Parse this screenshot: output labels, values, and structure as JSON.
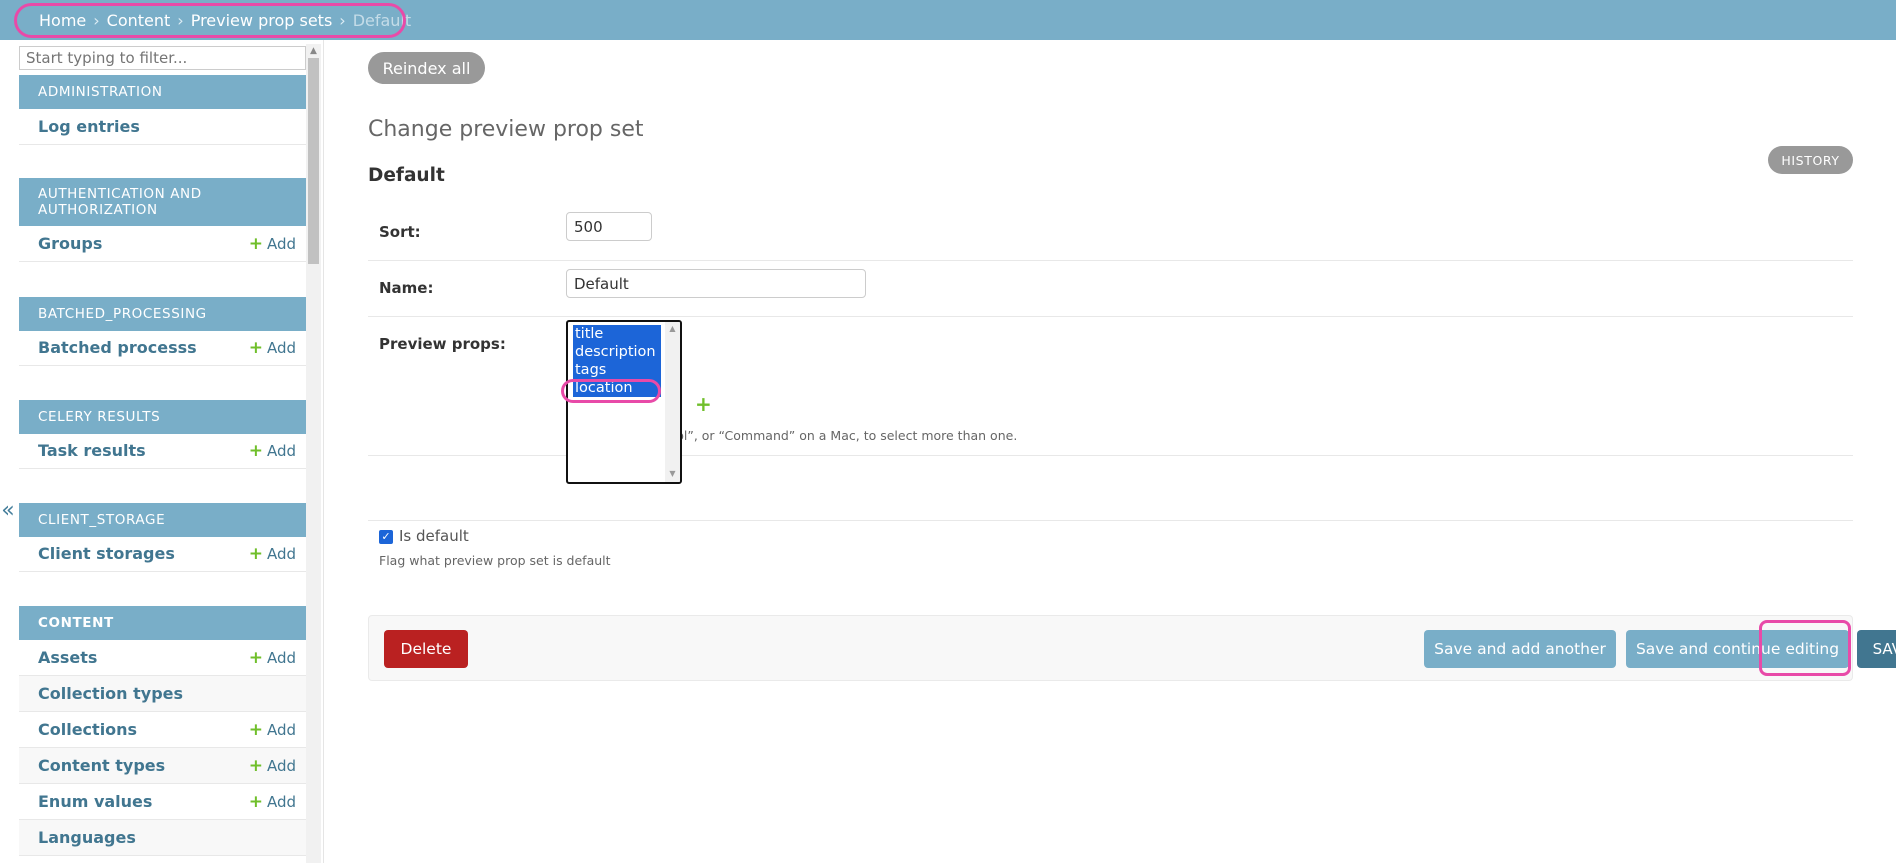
{
  "breadcrumb": {
    "items": [
      "Home",
      "Content",
      "Preview prop sets"
    ],
    "current": "Default",
    "separator": "›"
  },
  "sidebar": {
    "filter_placeholder": "Start typing to filter...",
    "collapse_glyph": "«",
    "add_label": "Add",
    "modules": [
      {
        "header": "ADMINISTRATION",
        "items": [
          {
            "label": "Log entries"
          }
        ]
      },
      {
        "header": "AUTHENTICATION AND AUTHORIZATION",
        "items": [
          {
            "label": "Groups"
          }
        ]
      },
      {
        "header": "BATCHED_PROCESSING",
        "items": [
          {
            "label": "Batched processs"
          }
        ]
      },
      {
        "header": "CELERY RESULTS",
        "items": [
          {
            "label": "Task results"
          }
        ]
      },
      {
        "header": "CLIENT_STORAGE",
        "items": [
          {
            "label": "Client storages"
          }
        ]
      },
      {
        "header": "CONTENT",
        "items": [
          {
            "label": "Assets"
          },
          {
            "label": "Collection types"
          },
          {
            "label": "Collections"
          },
          {
            "label": "Content types"
          },
          {
            "label": "Enum values"
          },
          {
            "label": "Languages"
          }
        ]
      }
    ]
  },
  "main": {
    "reindex_label": "Reindex all",
    "page_title": "Change preview prop set",
    "object_title": "Default",
    "history_label": "HISTORY",
    "fields": {
      "sort": {
        "label": "Sort:",
        "value": "500"
      },
      "name": {
        "label": "Name:",
        "value": "Default"
      },
      "preview_props": {
        "label": "Preview props:",
        "options": [
          "title",
          "description",
          "tags",
          "location"
        ],
        "help": "Hold down “Control”, or “Command” on a Mac, to select more than one.",
        "add_glyph": "+"
      },
      "is_default": {
        "label": "Is default",
        "checked": true,
        "help": "Flag what preview prop set is default"
      }
    },
    "buttons": {
      "delete": "Delete",
      "save_add_another": "Save and add another",
      "save_continue": "Save and continue editing",
      "save": "SAVE"
    }
  },
  "colors": {
    "header_bar": "#79aec8",
    "link": "#417690",
    "add_plus": "#70bf2b",
    "delete": "#ba2121",
    "annotation": "#e84aa8",
    "selection": "#1c65d8"
  }
}
